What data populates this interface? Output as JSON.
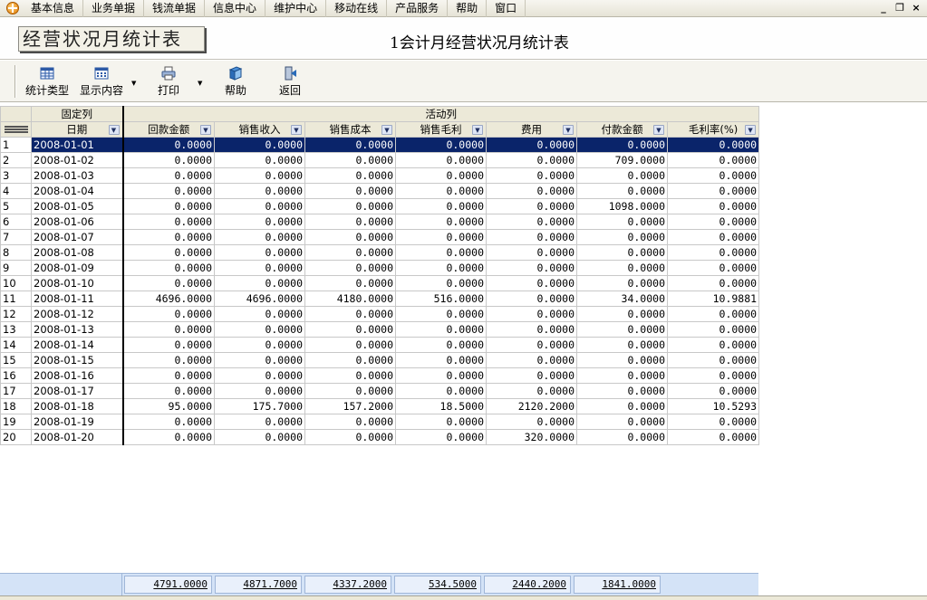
{
  "menu": {
    "items": [
      "基本信息",
      "业务单据",
      "钱流单据",
      "信息中心",
      "维护中心",
      "移动在线",
      "产品服务",
      "帮助",
      "窗口"
    ],
    "win_minimize": "_",
    "win_restore": "❐",
    "win_close": "×"
  },
  "title": {
    "banner": "经营状况月统计表",
    "report": "1会计月经营状况月统计表"
  },
  "toolbar": {
    "stat_type": "统计类型",
    "display_content": "显示内容",
    "print": "打印",
    "help": "帮助",
    "back": "返回",
    "dropdown_arrow": "▼"
  },
  "grid": {
    "group_fixed": "固定列",
    "group_active": "活动列",
    "filter_glyph": "▼",
    "columns": [
      "日期",
      "回款金额",
      "销售收入",
      "销售成本",
      "销售毛利",
      "费用",
      "付款金额",
      "毛利率(%)"
    ],
    "rows": [
      {
        "n": "1",
        "date": "2008-01-01",
        "v": [
          "0.0000",
          "0.0000",
          "0.0000",
          "0.0000",
          "0.0000",
          "0.0000",
          "0.0000"
        ]
      },
      {
        "n": "2",
        "date": "2008-01-02",
        "v": [
          "0.0000",
          "0.0000",
          "0.0000",
          "0.0000",
          "0.0000",
          "709.0000",
          "0.0000"
        ]
      },
      {
        "n": "3",
        "date": "2008-01-03",
        "v": [
          "0.0000",
          "0.0000",
          "0.0000",
          "0.0000",
          "0.0000",
          "0.0000",
          "0.0000"
        ]
      },
      {
        "n": "4",
        "date": "2008-01-04",
        "v": [
          "0.0000",
          "0.0000",
          "0.0000",
          "0.0000",
          "0.0000",
          "0.0000",
          "0.0000"
        ]
      },
      {
        "n": "5",
        "date": "2008-01-05",
        "v": [
          "0.0000",
          "0.0000",
          "0.0000",
          "0.0000",
          "0.0000",
          "1098.0000",
          "0.0000"
        ]
      },
      {
        "n": "6",
        "date": "2008-01-06",
        "v": [
          "0.0000",
          "0.0000",
          "0.0000",
          "0.0000",
          "0.0000",
          "0.0000",
          "0.0000"
        ]
      },
      {
        "n": "7",
        "date": "2008-01-07",
        "v": [
          "0.0000",
          "0.0000",
          "0.0000",
          "0.0000",
          "0.0000",
          "0.0000",
          "0.0000"
        ]
      },
      {
        "n": "8",
        "date": "2008-01-08",
        "v": [
          "0.0000",
          "0.0000",
          "0.0000",
          "0.0000",
          "0.0000",
          "0.0000",
          "0.0000"
        ]
      },
      {
        "n": "9",
        "date": "2008-01-09",
        "v": [
          "0.0000",
          "0.0000",
          "0.0000",
          "0.0000",
          "0.0000",
          "0.0000",
          "0.0000"
        ]
      },
      {
        "n": "10",
        "date": "2008-01-10",
        "v": [
          "0.0000",
          "0.0000",
          "0.0000",
          "0.0000",
          "0.0000",
          "0.0000",
          "0.0000"
        ]
      },
      {
        "n": "11",
        "date": "2008-01-11",
        "v": [
          "4696.0000",
          "4696.0000",
          "4180.0000",
          "516.0000",
          "0.0000",
          "34.0000",
          "10.9881"
        ]
      },
      {
        "n": "12",
        "date": "2008-01-12",
        "v": [
          "0.0000",
          "0.0000",
          "0.0000",
          "0.0000",
          "0.0000",
          "0.0000",
          "0.0000"
        ]
      },
      {
        "n": "13",
        "date": "2008-01-13",
        "v": [
          "0.0000",
          "0.0000",
          "0.0000",
          "0.0000",
          "0.0000",
          "0.0000",
          "0.0000"
        ]
      },
      {
        "n": "14",
        "date": "2008-01-14",
        "v": [
          "0.0000",
          "0.0000",
          "0.0000",
          "0.0000",
          "0.0000",
          "0.0000",
          "0.0000"
        ]
      },
      {
        "n": "15",
        "date": "2008-01-15",
        "v": [
          "0.0000",
          "0.0000",
          "0.0000",
          "0.0000",
          "0.0000",
          "0.0000",
          "0.0000"
        ]
      },
      {
        "n": "16",
        "date": "2008-01-16",
        "v": [
          "0.0000",
          "0.0000",
          "0.0000",
          "0.0000",
          "0.0000",
          "0.0000",
          "0.0000"
        ]
      },
      {
        "n": "17",
        "date": "2008-01-17",
        "v": [
          "0.0000",
          "0.0000",
          "0.0000",
          "0.0000",
          "0.0000",
          "0.0000",
          "0.0000"
        ]
      },
      {
        "n": "18",
        "date": "2008-01-18",
        "v": [
          "95.0000",
          "175.7000",
          "157.2000",
          "18.5000",
          "2120.2000",
          "0.0000",
          "10.5293"
        ]
      },
      {
        "n": "19",
        "date": "2008-01-19",
        "v": [
          "0.0000",
          "0.0000",
          "0.0000",
          "0.0000",
          "0.0000",
          "0.0000",
          "0.0000"
        ]
      },
      {
        "n": "20",
        "date": "2008-01-20",
        "v": [
          "0.0000",
          "0.0000",
          "0.0000",
          "0.0000",
          "320.0000",
          "0.0000",
          "0.0000"
        ]
      }
    ],
    "selected_row": 0
  },
  "footer": {
    "totals": [
      "4791.0000",
      "4871.7000",
      "4337.2000",
      "534.5000",
      "2440.2000",
      "1841.0000"
    ]
  }
}
